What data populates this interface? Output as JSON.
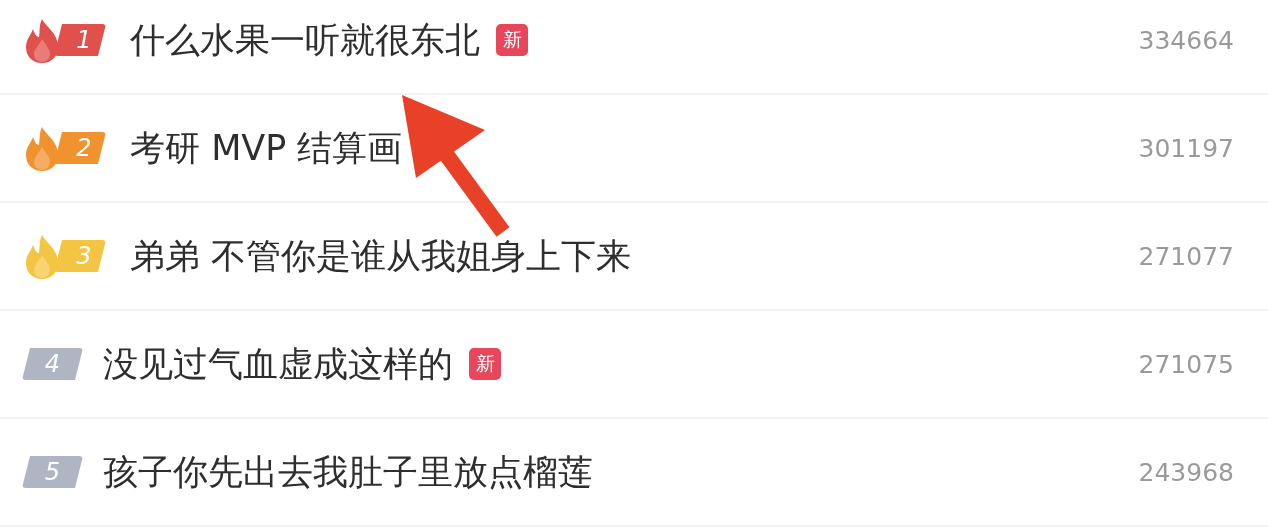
{
  "items": [
    {
      "rank": "1",
      "kind": "hot",
      "color": "#e0504c",
      "title": "什么水果一听就很东北",
      "is_new": true,
      "new_label": "新",
      "count": "334664"
    },
    {
      "rank": "2",
      "kind": "hot",
      "color": "#f0922e",
      "title": "考研 MVP 结算画",
      "is_new": false,
      "count": "301197"
    },
    {
      "rank": "3",
      "kind": "hot",
      "color": "#f4c443",
      "title": "弟弟 不管你是谁从我姐身上下来",
      "is_new": false,
      "count": "271077"
    },
    {
      "rank": "4",
      "kind": "plain",
      "color": "#b0b5c3",
      "title": "没见过气血虚成这样的",
      "is_new": true,
      "new_label": "新",
      "count": "271075"
    },
    {
      "rank": "5",
      "kind": "plain",
      "color": "#b0b5c3",
      "title": "孩子你先出去我肚子里放点榴莲",
      "is_new": false,
      "count": "243968"
    }
  ]
}
